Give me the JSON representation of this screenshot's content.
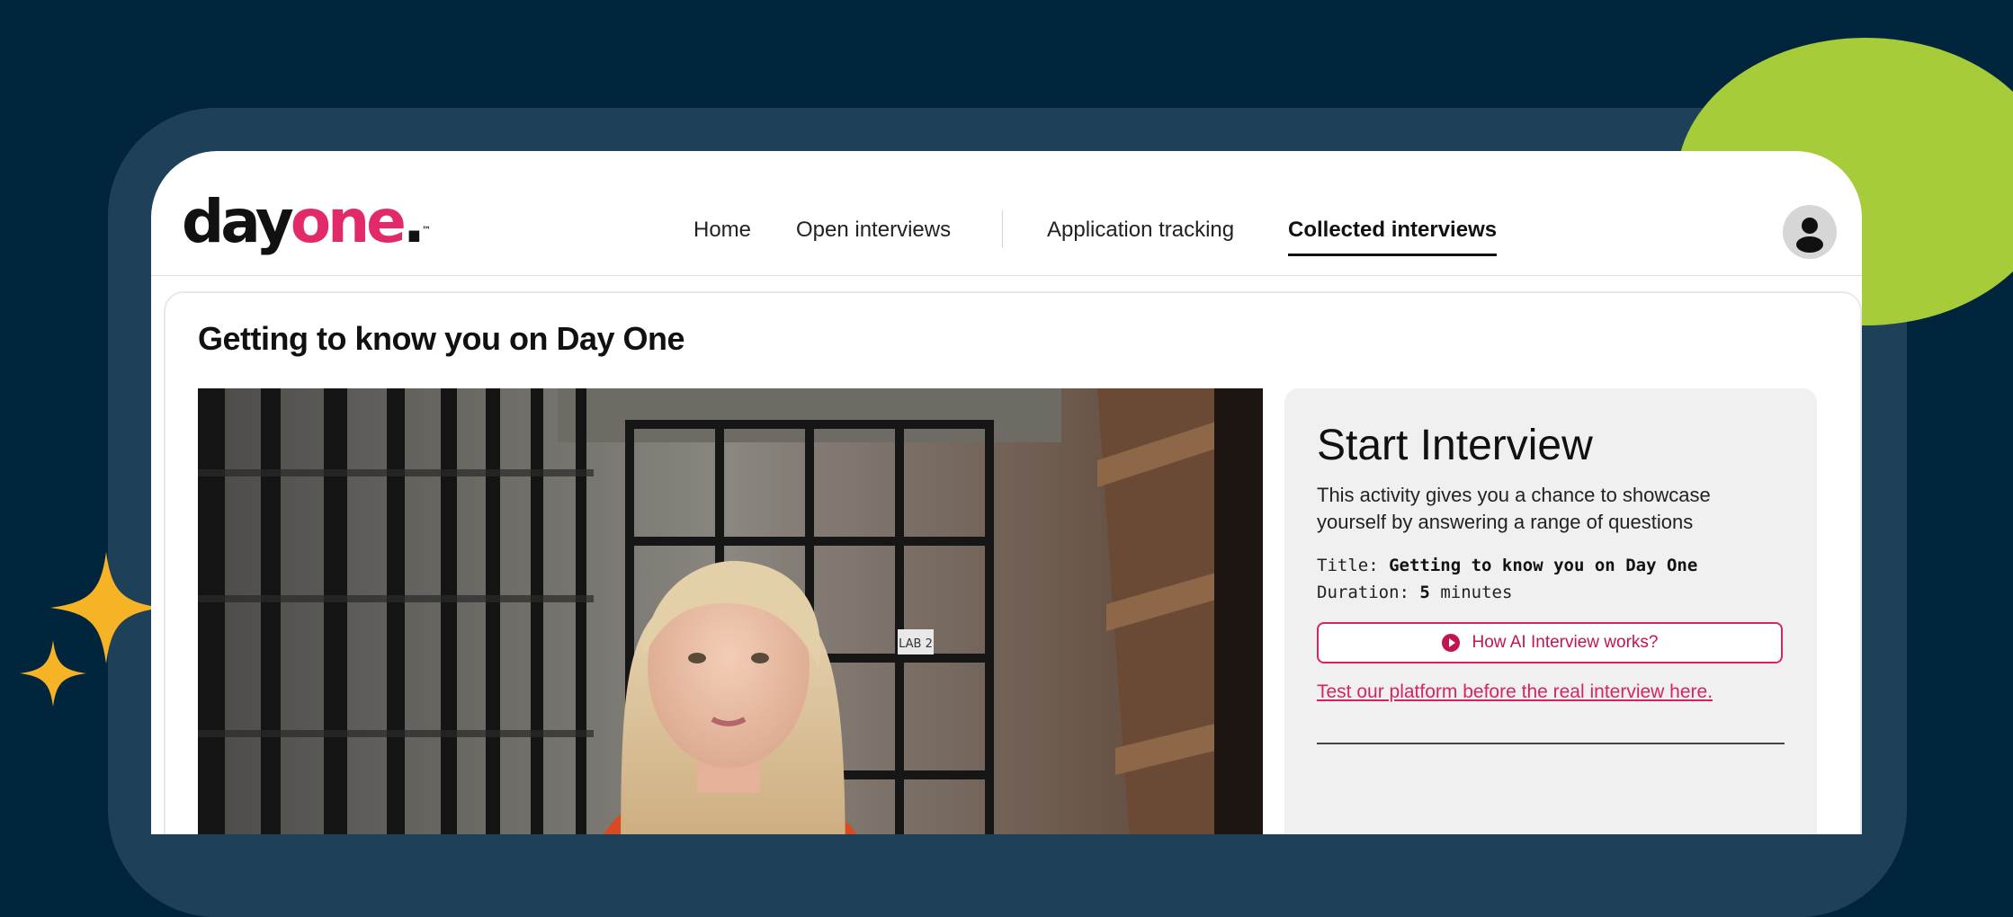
{
  "brand": {
    "logo_day": "day",
    "logo_one": "one",
    "logo_dot": ".",
    "logo_tm": "™",
    "accent_color": "#e22a6b"
  },
  "nav": {
    "items": [
      {
        "label": "Home",
        "active": false
      },
      {
        "label": "Open interviews",
        "active": false
      },
      {
        "label": "Application tracking",
        "active": false
      },
      {
        "label": "Collected interviews",
        "active": true
      }
    ]
  },
  "user": {
    "avatar_icon": "user-avatar-icon"
  },
  "page": {
    "title": "Getting to know you on Day One"
  },
  "video": {
    "scene_text": "LAB 2"
  },
  "panel": {
    "title": "Start Interview",
    "description": "This activity gives you a chance to showcase yourself by answering a range of questions",
    "meta_title_label": "Title:",
    "meta_title_value": "Getting to know you on Day One",
    "meta_duration_label": "Duration:",
    "meta_duration_value": "5",
    "meta_duration_unit": "minutes",
    "how_button_label": "How AI Interview works?",
    "how_button_icon": "play-circle-icon",
    "test_link_label": "Test our platform before the real interview here."
  },
  "colors": {
    "background": "#02253e",
    "frame": "#1f4059",
    "decor_green": "#a6cc3a",
    "decor_star": "#f5b325"
  }
}
